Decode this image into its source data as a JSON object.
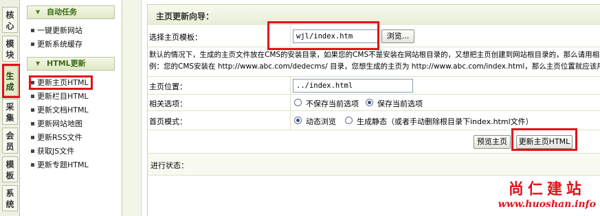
{
  "tabs": [
    {
      "label": "核心",
      "active": false
    },
    {
      "label": "模块",
      "active": false
    },
    {
      "label": "生成",
      "active": true
    },
    {
      "label": "采集",
      "active": false
    },
    {
      "label": "会员",
      "active": false
    },
    {
      "label": "模板",
      "active": false
    },
    {
      "label": "系统",
      "active": false
    }
  ],
  "sidebar": {
    "section1": {
      "title": "自动任务",
      "items": [
        "一键更新网站",
        "更新系统缓存"
      ]
    },
    "section2": {
      "title": "HTML更新",
      "items": [
        "更新主页HTML",
        "更新栏目HTML",
        "更新文档HTML",
        "更新网站地图",
        "更新RSS文件",
        "获取JS文件",
        "更新专题HTML"
      ]
    }
  },
  "main": {
    "title": "主页更新向导：",
    "template_label": "选择主页模板：",
    "template_value": "wjl/index.htm",
    "browse_button": "浏览...",
    "note_line1": "默认的情况下，生成的主页文件放在CMS的安装目录，如果您的CMS不是安装在网站根目录的，又想把主页创建到网站根目录的，那么请用相",
    "note_line2": "例：您的CMS安装在 http://www.abc.com/dedecms/ 目录，您想生成的主页为 http://www.abc.com/index.html，那么主页位置就应该用",
    "position_label": "主页位置：",
    "position_value": "../index.html",
    "options_label": "相关选项：",
    "option_nosave": "不保存当前选项",
    "option_save": "保存当前选项",
    "mode_label": "首页模式：",
    "mode_dynamic": "动态浏览",
    "mode_static": "生成静态（或者手动删除根目录下index.html文件）",
    "preview_button": "预览主页",
    "update_button": "更新主页HTML",
    "status_label": "进行状态："
  },
  "watermark": {
    "cn": "尚仁建站",
    "url": "www.huoshan.info"
  },
  "colors": {
    "accent_red": "#e0121a",
    "section_green": "#3a6a10",
    "border_green": "#c9d4ae"
  }
}
